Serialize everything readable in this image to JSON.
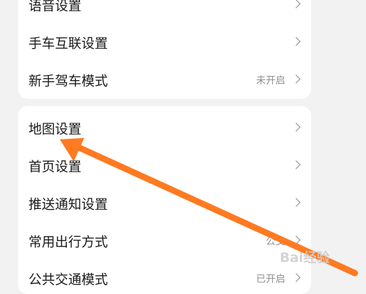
{
  "group1": {
    "items": [
      {
        "label": "语音设置",
        "value": ""
      },
      {
        "label": "手车互联设置",
        "value": ""
      },
      {
        "label": "新手驾车模式",
        "value": "未开启"
      }
    ]
  },
  "group2": {
    "items": [
      {
        "label": "地图设置",
        "value": ""
      },
      {
        "label": "首页设置",
        "value": ""
      },
      {
        "label": "推送通知设置",
        "value": ""
      },
      {
        "label": "常用出行方式",
        "value": "公交"
      },
      {
        "label": "公共交通模式",
        "value": "已开启"
      }
    ]
  },
  "annotation": {
    "arrow_color": "#ff7a21"
  },
  "watermark": {
    "text": "Bai经验"
  }
}
